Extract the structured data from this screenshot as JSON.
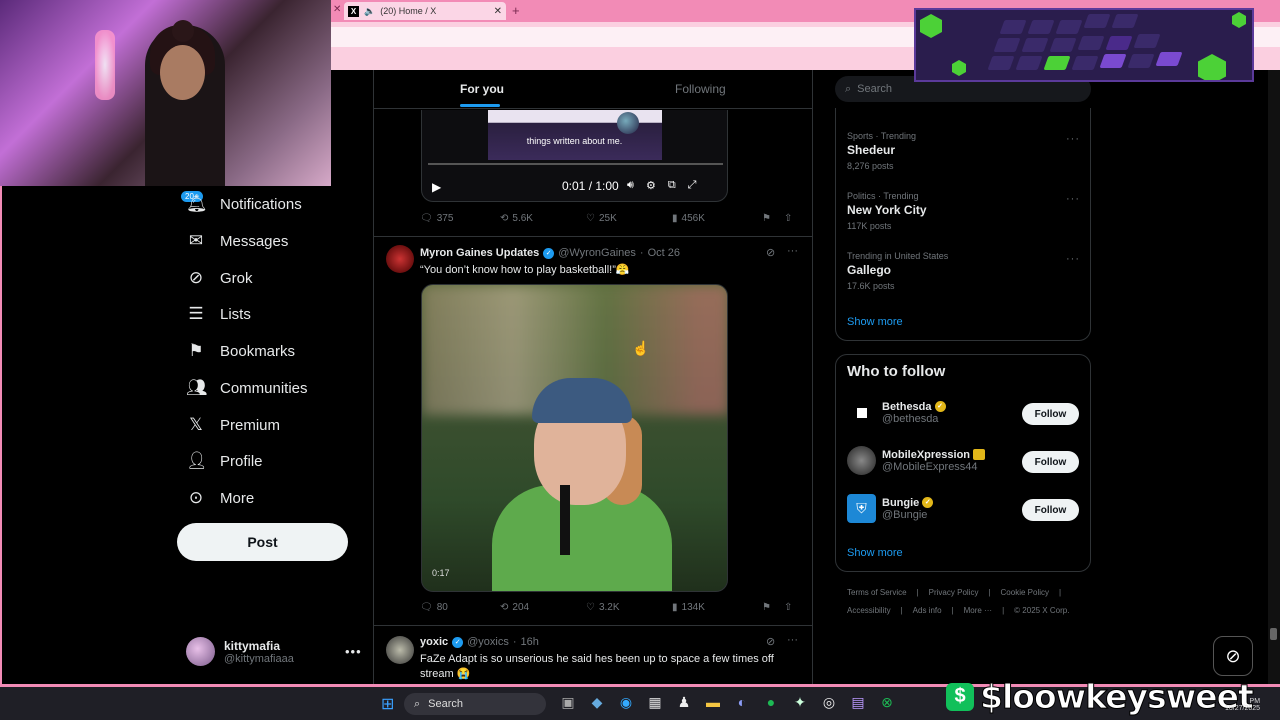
{
  "browser": {
    "tab_title": "(20) Home / X"
  },
  "nav": {
    "notif_badge": "20+",
    "items": [
      {
        "label": "Notifications",
        "icon": "bell-icon"
      },
      {
        "label": "Messages",
        "icon": "envelope-icon"
      },
      {
        "label": "Grok",
        "icon": "grok-icon"
      },
      {
        "label": "Lists",
        "icon": "list-icon"
      },
      {
        "label": "Bookmarks",
        "icon": "bookmark-icon"
      },
      {
        "label": "Communities",
        "icon": "people-icon"
      },
      {
        "label": "Premium",
        "icon": "x-logo-icon"
      },
      {
        "label": "Profile",
        "icon": "person-icon"
      },
      {
        "label": "More",
        "icon": "more-circle-icon"
      }
    ],
    "post_button": "Post",
    "account": {
      "name": "kittymafia",
      "handle": "@kittymafiaaa"
    }
  },
  "feed": {
    "tabs": {
      "for_you": "For you",
      "following": "Following"
    },
    "post1": {
      "video_caption": "things written about me.",
      "video_time": "0:01 / 1:00",
      "replies": "375",
      "reposts": "5.6K",
      "likes": "25K",
      "views": "456K"
    },
    "post2": {
      "name": "Myron Gaines Updates",
      "handle": "@WyronGaines",
      "time": "Oct 26",
      "text": "“You don’t know how to play basketball!”😤",
      "media_duration": "0:17",
      "replies": "80",
      "reposts": "204",
      "likes": "3.2K",
      "views": "134K"
    },
    "post3": {
      "name": "yoxic",
      "handle": "@yoxics",
      "time": "16h",
      "text": "FaZe Adapt is so unserious he said hes been up to space a few times off stream 😭"
    }
  },
  "right": {
    "search_placeholder": "Search",
    "trends": [
      {
        "category": "Sports · Trending",
        "name": "Shedeur",
        "count": "8,276 posts"
      },
      {
        "category": "Politics · Trending",
        "name": "New York City",
        "count": "117K posts"
      },
      {
        "category": "Trending in United States",
        "name": "Gallego",
        "count": "17.6K posts"
      }
    ],
    "show_more": "Show more",
    "who_to_follow": {
      "title": "Who to follow",
      "accounts": [
        {
          "name": "Bethesda",
          "handle": "@bethesda",
          "badge": "gold"
        },
        {
          "name": "MobileXpression",
          "handle": "@MobileExpress44",
          "badge": "gold-square"
        },
        {
          "name": "Bungie",
          "handle": "@Bungie",
          "badge": "gold"
        }
      ],
      "follow_label": "Follow",
      "show_more": "Show more"
    },
    "footer": {
      "row1": [
        "Terms of Service",
        "Privacy Policy",
        "Cookie Policy"
      ],
      "row2": [
        "Accessibility",
        "Ads info",
        "More ···",
        "© 2025 X Corp."
      ]
    }
  },
  "taskbar": {
    "search_label": "Search",
    "streamer_tag": "$loowkeysweet",
    "date": "10/27/2025",
    "time_suffix": "PM"
  },
  "colors": {
    "accent": "#1d9bf0",
    "browser_pink": "#f28bb6"
  }
}
